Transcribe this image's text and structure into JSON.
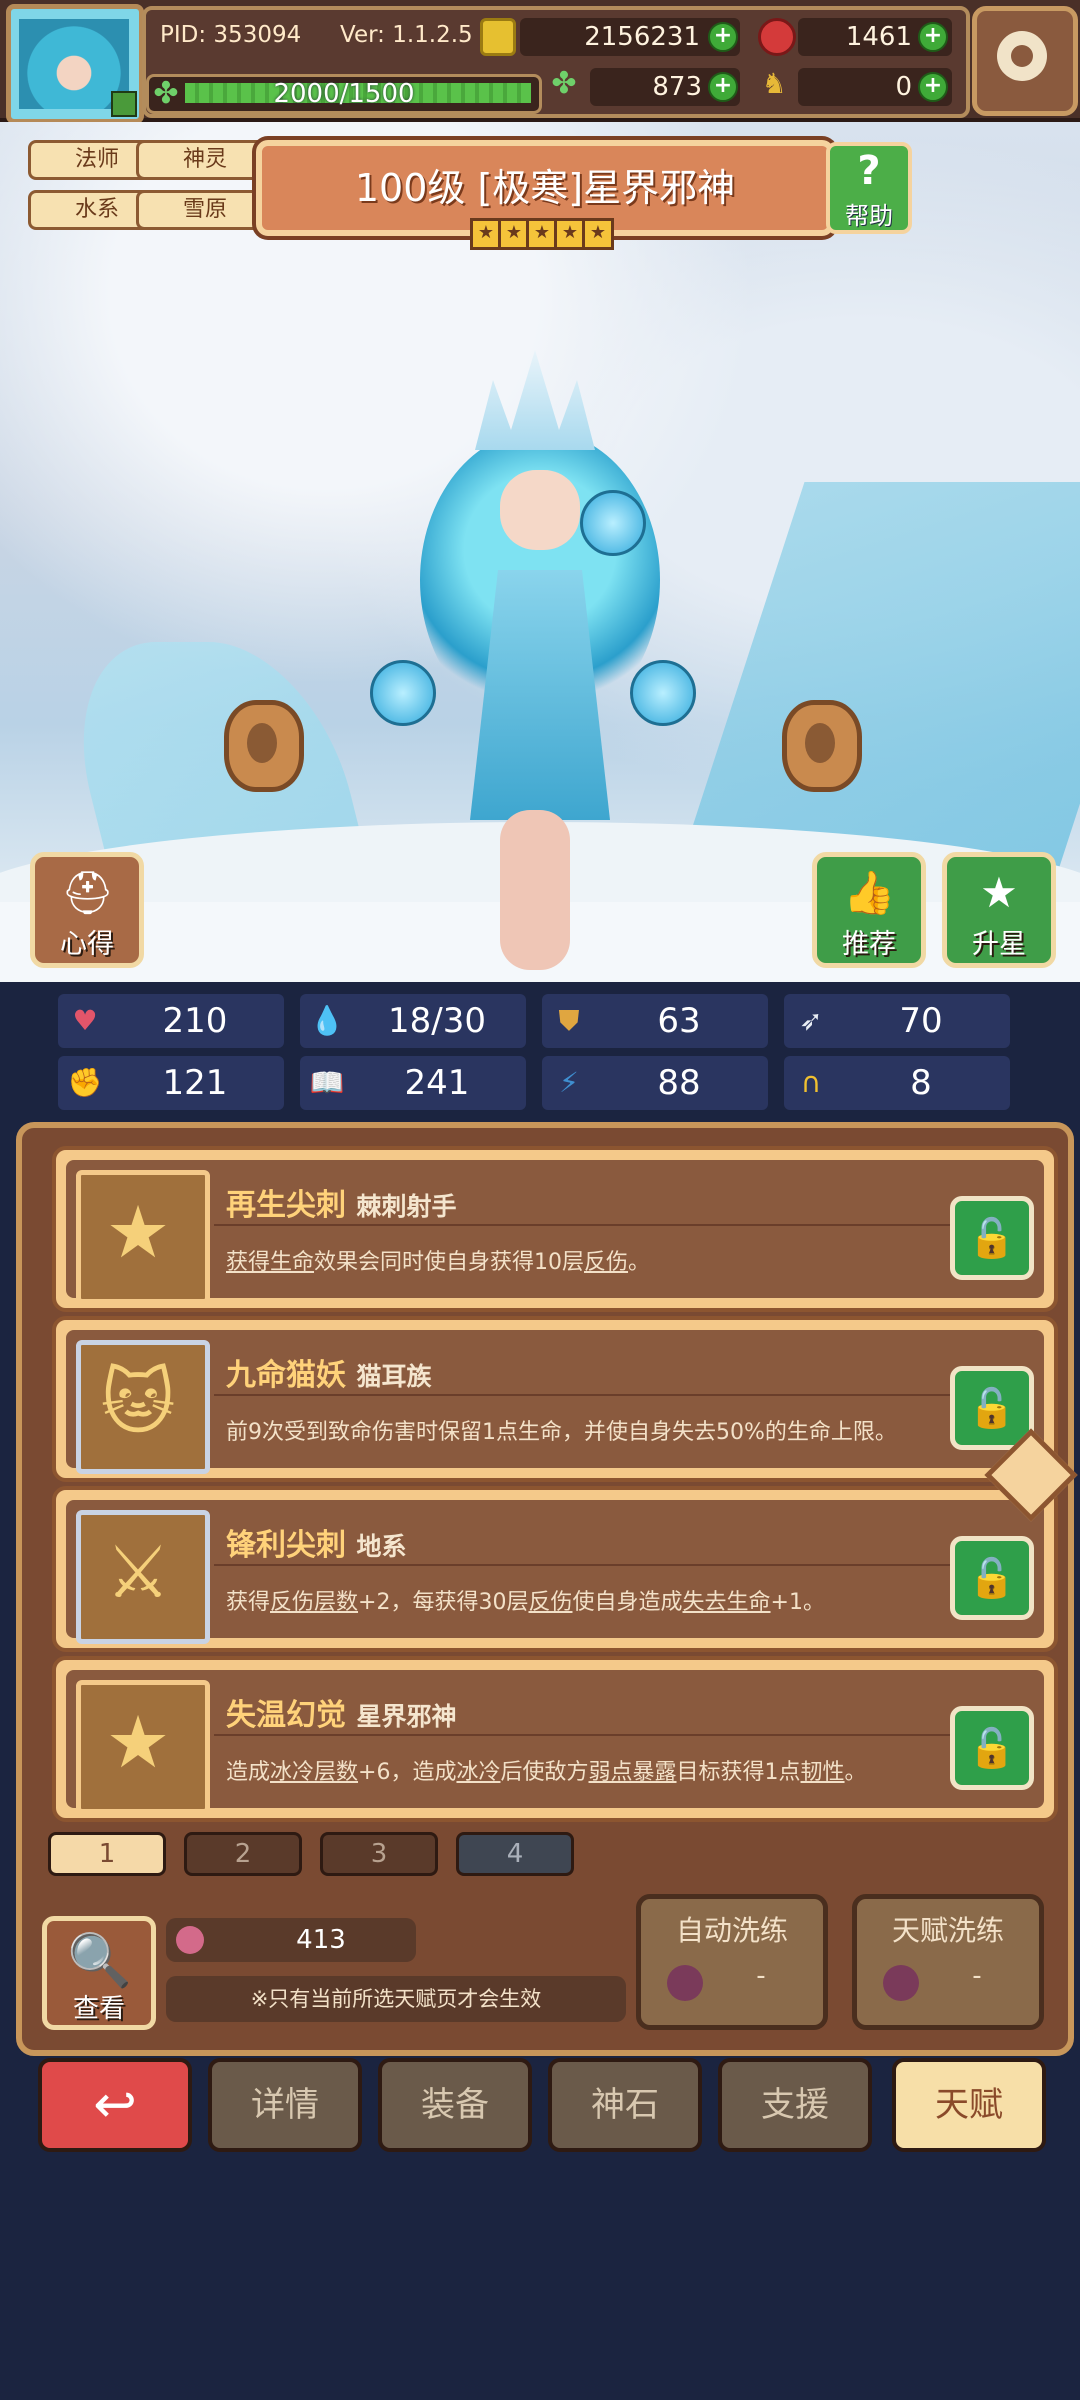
{
  "header": {
    "pid": "PID: 353094",
    "version": "Ver: 1.1.2.5",
    "gold": "2156231",
    "ruby": "1461",
    "clover": "873",
    "horn": "0",
    "stamina_text": "2000/1500",
    "stamina_fraction": 1.0
  },
  "hero": {
    "tags": [
      "法师",
      "神灵",
      "水系",
      "雪原"
    ],
    "title": "100级 [极寒]星界邪神",
    "stars": 5,
    "help_label": "帮助",
    "insight_label": "心得",
    "recommend_label": "推荐",
    "upgrade_label": "升星"
  },
  "stats": [
    {
      "icon": "heart-icon",
      "value": "210"
    },
    {
      "icon": "water-drop-icon",
      "value": "18/30"
    },
    {
      "icon": "shield-icon",
      "value": "63"
    },
    {
      "icon": "wing-icon",
      "value": "70"
    },
    {
      "icon": "fist-icon",
      "value": "121"
    },
    {
      "icon": "book-icon",
      "value": "241"
    },
    {
      "icon": "boot-icon",
      "value": "88"
    },
    {
      "icon": "horseshoe-icon",
      "value": "8"
    }
  ],
  "talents": [
    {
      "name": "再生尖刺",
      "source": "棘刺射手",
      "desc_parts": [
        "获得生命",
        "效果会同时使自身获得10层",
        "反伤",
        "。"
      ],
      "icon": "star-icon",
      "frame": "gold"
    },
    {
      "name": "九命猫妖",
      "source": "猫耳族",
      "desc_parts": [
        "前9次受到致命伤害时保留1点生命，并使自身失去50%的生命上限。"
      ],
      "icon": "cat-icon",
      "frame": "silver"
    },
    {
      "name": "锋利尖刺",
      "source": "地系",
      "desc_parts": [
        "获得",
        "反伤层数",
        "+2，每获得30层",
        "反伤",
        "使自身造成",
        "失去生命",
        "+1。"
      ],
      "icon": "crossed-swords-icon",
      "frame": "silver"
    },
    {
      "name": "失温幻觉",
      "source": "星界邪神",
      "desc_parts": [
        "造成",
        "冰冷层数",
        "+6，造成",
        "冰冷",
        "后使敌方",
        "弱点暴露",
        "目标获得1点",
        "韧性",
        "。"
      ],
      "icon": "star-icon",
      "frame": "gold"
    }
  ],
  "pages": [
    "1",
    "2",
    "3",
    "4"
  ],
  "footer": {
    "view_label": "查看",
    "fruit_count": "413",
    "note": "※只有当前所选天赋页才会生效",
    "auto_wash_label": "自动洗练",
    "auto_wash_value": "-",
    "talent_wash_label": "天赋洗练",
    "talent_wash_value": "-"
  },
  "nav": {
    "details": "详情",
    "equip": "装备",
    "stone": "神石",
    "support": "支援",
    "talent": "天赋"
  },
  "colors": {
    "accent_gold": "#f5d39e",
    "panel_brown": "#7a4a32",
    "back_red": "#e04a4a",
    "lock_green": "#2f9f4a"
  }
}
